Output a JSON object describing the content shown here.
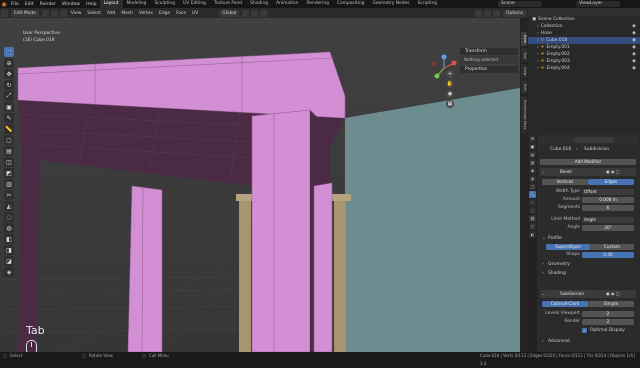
{
  "topbar": {
    "menus": [
      "File",
      "Edit",
      "Render",
      "Window",
      "Help"
    ],
    "workspaces": [
      "Layout",
      "Modeling",
      "Sculpting",
      "UV Editing",
      "Texture Paint",
      "Shading",
      "Animation",
      "Rendering",
      "Compositing",
      "Geometry Nodes",
      "Scripting"
    ],
    "active_workspace": "Layout",
    "scene": "Scene",
    "view_layer": "ViewLayer"
  },
  "header": {
    "mode": "Edit Mode",
    "menus": [
      "View",
      "Select",
      "Add",
      "Mesh",
      "Vertex",
      "Edge",
      "Face",
      "UV"
    ],
    "orientation": "Global",
    "options": "Options"
  },
  "viewport": {
    "view_name": "User Perspective",
    "object_name": "(16) Cube.018",
    "key_shown": "Tab"
  },
  "npanel": {
    "transform_header": "Transform",
    "transform_body": "Nothing selected",
    "properties_header": "Properties"
  },
  "side_tabs": [
    "Item",
    "Tool",
    "View",
    "Edit",
    "Screencast Keys"
  ],
  "outliner": {
    "title": "Scene Collection",
    "items": [
      {
        "label": "Collection",
        "indent": 1
      },
      {
        "label": "Hose",
        "indent": 1
      },
      {
        "label": "Cube.018",
        "indent": 1,
        "selected": true
      },
      {
        "label": "Empty.001",
        "indent": 1
      },
      {
        "label": "Empty.002",
        "indent": 1
      },
      {
        "label": "Empty.003",
        "indent": 1
      },
      {
        "label": "Empty.004",
        "indent": 1
      }
    ]
  },
  "properties": {
    "object": "Cube.018",
    "modifier_context": "Subdivision",
    "add_modifier": "Add Modifier",
    "bevel": {
      "name": "Bevel",
      "affect_vertices": "Vertices",
      "affect_edges": "Edges",
      "width_type_label": "Width Type",
      "width_type": "Offset",
      "amount_label": "Amount",
      "amount": "0.008 m",
      "segments_label": "Segments",
      "segments": "6",
      "limit_method_label": "Limit Method",
      "limit_method": "Angle",
      "angle_label": "Angle",
      "angle": "30°",
      "profile_label": "Profile",
      "profile_superellipse": "Superellipse",
      "profile_custom": "Custom",
      "shape_label": "Shape",
      "shape": "0.50",
      "geometry_label": "Geometry",
      "shading_label": "Shading"
    },
    "subdivision": {
      "name": "Subdivision",
      "catmull": "Catmull-Clark",
      "simple": "Simple",
      "levels_viewport_label": "Levels Viewport",
      "levels_viewport": "2",
      "render_label": "Render",
      "render": "2",
      "optimal_display": "Optimal Display",
      "advanced_label": "Advanced"
    }
  },
  "statusbar": {
    "select": "Select",
    "rotate": "Rotate View",
    "call_menu": "Call Menu",
    "stats": "Cube.018 | Verts 0/112 | Edges 0/224 | Faces 0/112 | Tris 0/224 | Objects 1/4 | 3.4"
  },
  "colors": {
    "pink_mesh": "#d38fd3",
    "dark_face": "#4a2a44",
    "accent": "#4772b3",
    "background_grid": "#3b3b3b"
  }
}
